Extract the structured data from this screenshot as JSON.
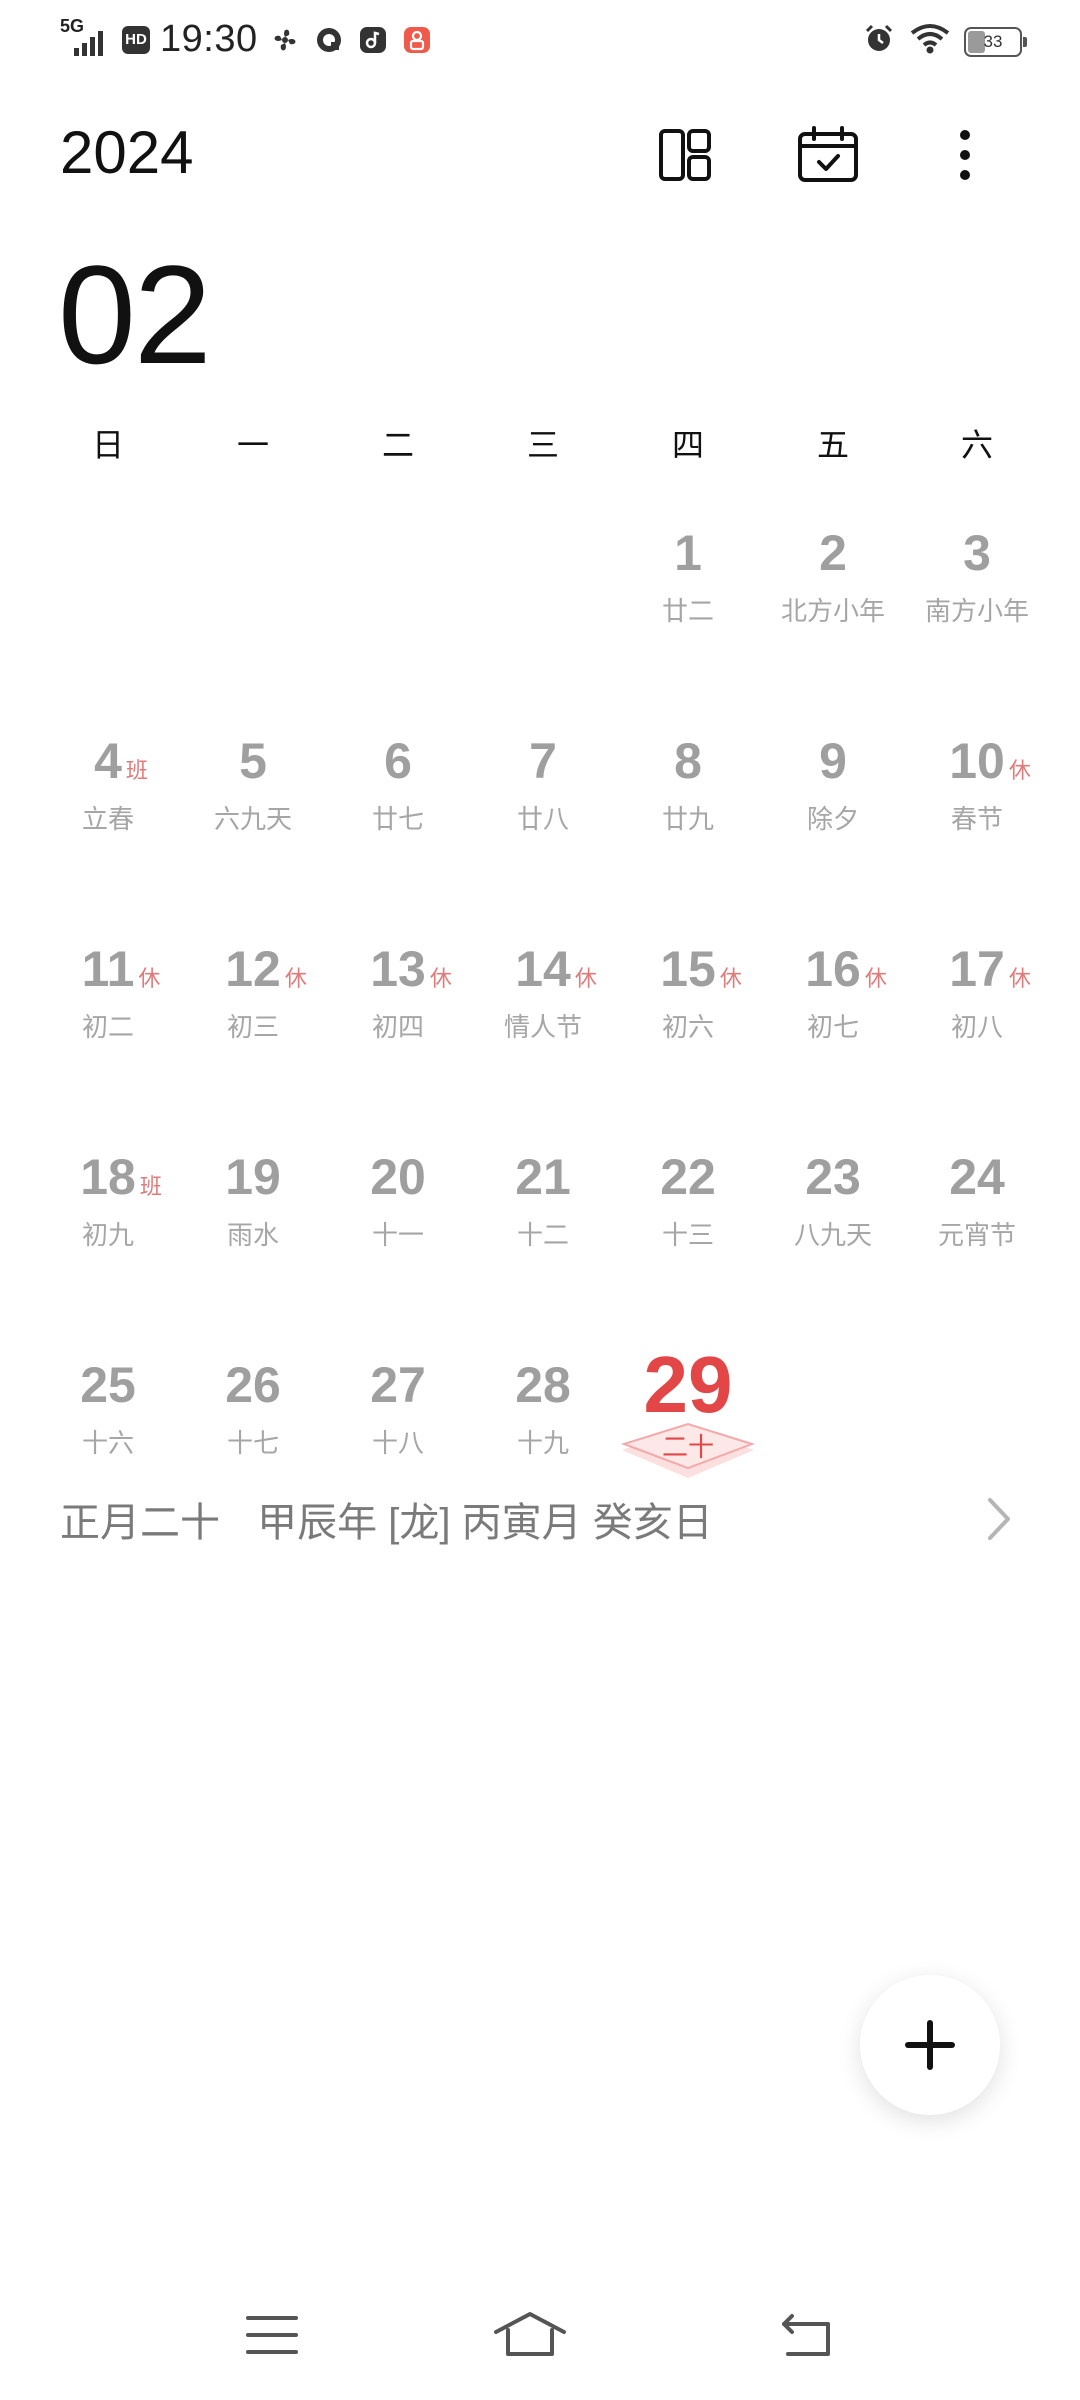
{
  "status_bar": {
    "network": "5G",
    "hd": "HD",
    "time": "19:30",
    "battery": "33"
  },
  "header": {
    "year": "2024",
    "month": "02"
  },
  "weekdays": [
    "日",
    "一",
    "二",
    "三",
    "四",
    "五",
    "六"
  ],
  "calendar": {
    "days": [
      {
        "day": "1",
        "lunar": "廿二"
      },
      {
        "day": "2",
        "lunar": "北方小年"
      },
      {
        "day": "3",
        "lunar": "南方小年"
      },
      {
        "day": "4",
        "lunar": "立春",
        "tag": "班"
      },
      {
        "day": "5",
        "lunar": "六九天"
      },
      {
        "day": "6",
        "lunar": "廿七"
      },
      {
        "day": "7",
        "lunar": "廿八"
      },
      {
        "day": "8",
        "lunar": "廿九"
      },
      {
        "day": "9",
        "lunar": "除夕"
      },
      {
        "day": "10",
        "lunar": "春节",
        "tag": "休"
      },
      {
        "day": "11",
        "lunar": "初二",
        "tag": "休"
      },
      {
        "day": "12",
        "lunar": "初三",
        "tag": "休"
      },
      {
        "day": "13",
        "lunar": "初四",
        "tag": "休"
      },
      {
        "day": "14",
        "lunar": "情人节",
        "tag": "休"
      },
      {
        "day": "15",
        "lunar": "初六",
        "tag": "休"
      },
      {
        "day": "16",
        "lunar": "初七",
        "tag": "休"
      },
      {
        "day": "17",
        "lunar": "初八",
        "tag": "休"
      },
      {
        "day": "18",
        "lunar": "初九",
        "tag": "班"
      },
      {
        "day": "19",
        "lunar": "雨水"
      },
      {
        "day": "20",
        "lunar": "十一"
      },
      {
        "day": "21",
        "lunar": "十二"
      },
      {
        "day": "22",
        "lunar": "十三"
      },
      {
        "day": "23",
        "lunar": "八九天"
      },
      {
        "day": "24",
        "lunar": "元宵节"
      },
      {
        "day": "25",
        "lunar": "十六"
      },
      {
        "day": "26",
        "lunar": "十七"
      },
      {
        "day": "27",
        "lunar": "十八"
      },
      {
        "day": "28",
        "lunar": "十九"
      },
      {
        "day": "29",
        "lunar": "二十",
        "today": true
      }
    ]
  },
  "selected_info": {
    "lunar_date": "正月二十",
    "ganzhi": "甲辰年 [龙] 丙寅月 癸亥日"
  },
  "colors": {
    "today": "#e34646",
    "tag": "#e07b7b",
    "muted": "#9f9f9f"
  },
  "icons": {
    "layout": "layout-icon",
    "calendar_check": "calendar-check-icon",
    "more": "more-vertical-icon",
    "add": "plus-icon",
    "chevron": "chevron-right-icon"
  }
}
